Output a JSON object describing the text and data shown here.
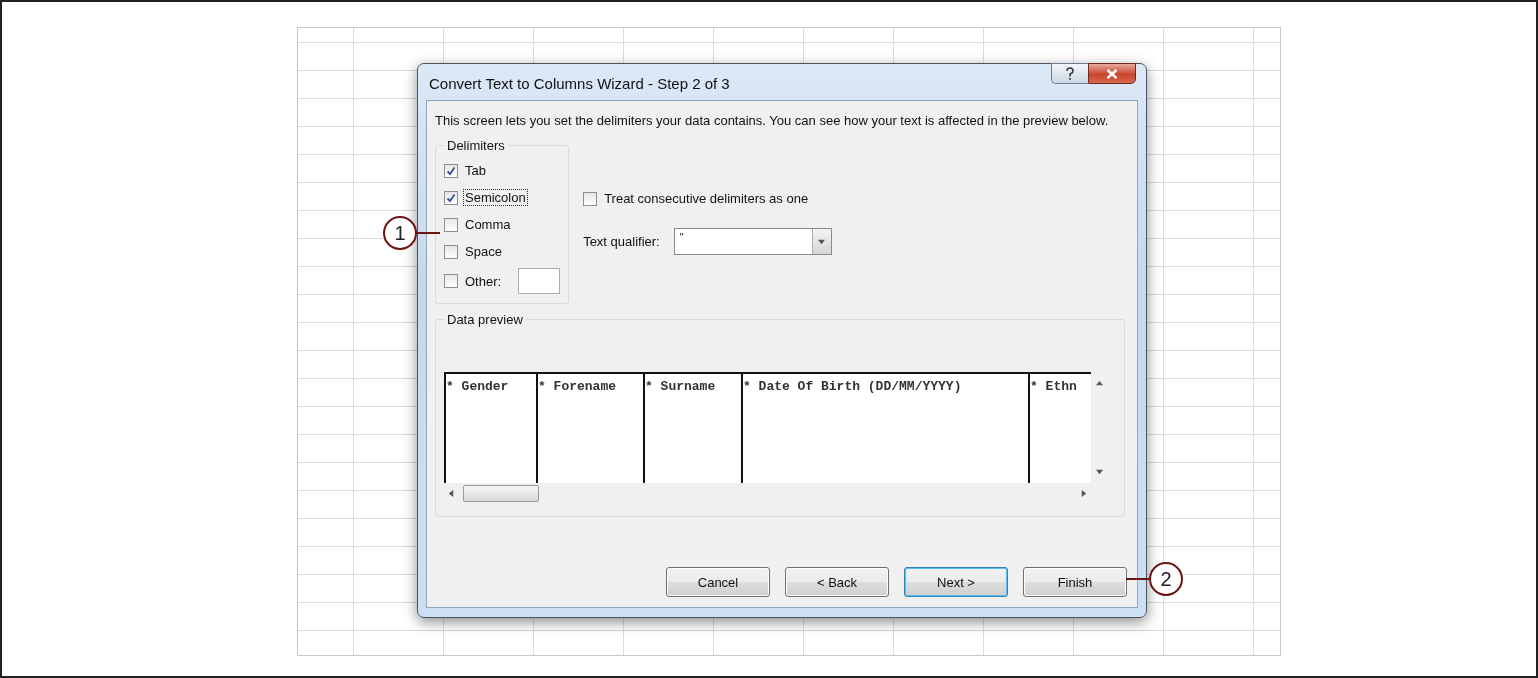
{
  "window": {
    "title": "Convert Text to Columns Wizard - Step 2 of 3"
  },
  "description": "This screen lets you set the delimiters your data contains.  You can see how your text is affected in the preview below.",
  "delimiters": {
    "title": "Delimiters",
    "items": [
      {
        "label": "Tab",
        "checked": true,
        "focused": false,
        "kind": "checkbox"
      },
      {
        "label": "Semicolon",
        "checked": true,
        "focused": true,
        "kind": "checkbox"
      },
      {
        "label": "Comma",
        "checked": false,
        "focused": false,
        "kind": "checkbox"
      },
      {
        "label": "Space",
        "checked": false,
        "focused": false,
        "kind": "checkbox"
      },
      {
        "label": "Other:",
        "checked": false,
        "focused": false,
        "kind": "checkbox_with_field"
      }
    ]
  },
  "consecutive": {
    "label": "Treat consecutive delimiters as one",
    "checked": false
  },
  "text_qualifier": {
    "label": "Text qualifier:",
    "value": "\""
  },
  "data_preview": {
    "title": "Data preview",
    "columns": [
      "* Gender",
      "* Forename",
      "* Surname",
      "* Date Of Birth (DD/MM/YYYY)",
      "* Ethn"
    ]
  },
  "buttons": [
    {
      "label": "Cancel",
      "default": false
    },
    {
      "label": "< Back",
      "default": false
    },
    {
      "label": "Next >",
      "default": true
    },
    {
      "label": "Finish",
      "default": false
    }
  ],
  "callouts": [
    {
      "label": "1"
    },
    {
      "label": "2"
    }
  ]
}
